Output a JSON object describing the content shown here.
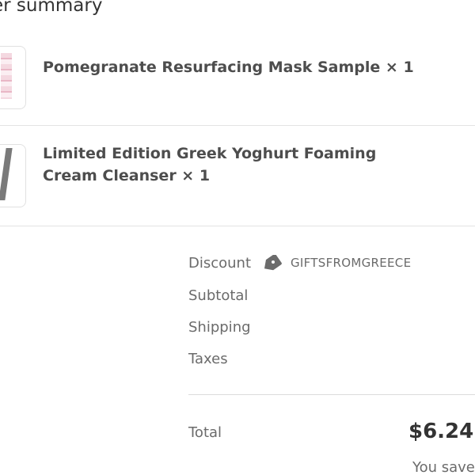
{
  "order_summary": {
    "heading": "er summary",
    "items": [
      {
        "name": "Pomegranate Resurfacing Mask Sample × 1",
        "thumbnail_icon": "pomegranate-mask-sample-thumbnail"
      },
      {
        "name": "Limited Edition Greek Yoghurt Foaming Cream Cleanser × 1",
        "thumbnail_icon": "cleanser-tube-thumbnail"
      }
    ]
  },
  "totals": {
    "discount_label": "Discount",
    "discount_icon": "tag-icon",
    "discount_code": "GIFTSFROMGREECE",
    "subtotal_label": "Subtotal",
    "shipping_label": "Shipping",
    "taxes_label": "Taxes",
    "total_label": "Total",
    "total_value": "$6.24",
    "savings_text": "You save"
  },
  "colors": {
    "text_primary": "#333333",
    "text_secondary": "#6b6b6b",
    "divider": "#e3e3e3"
  }
}
